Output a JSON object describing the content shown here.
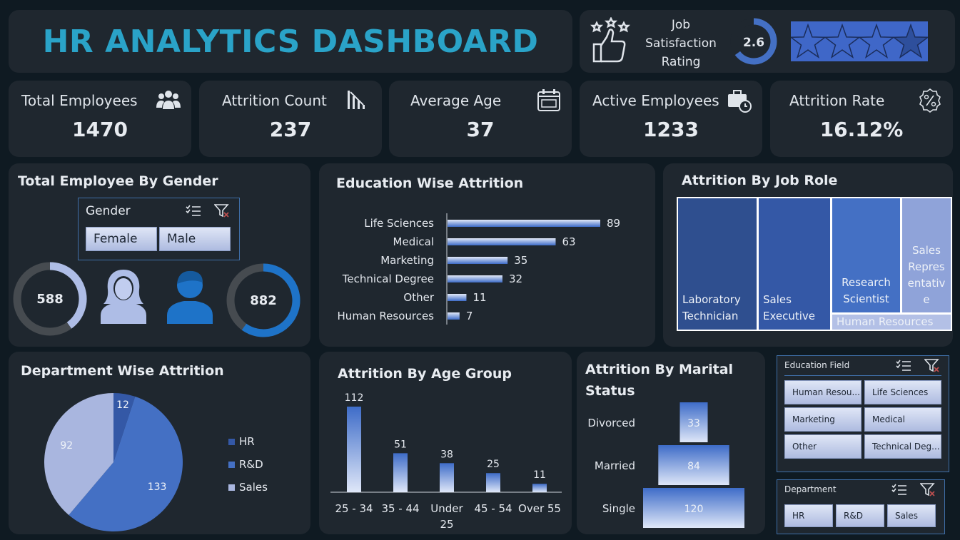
{
  "header": {
    "title": "HR ANALYTICS DASHBOARD"
  },
  "job_satisfaction": {
    "label_line1": "Job",
    "label_line2": "Satisfaction",
    "label_line3": "Rating",
    "value": "2.6",
    "rating_value": 2.6,
    "rating_max": 4
  },
  "kpis": [
    {
      "label": "Total Employees",
      "value": "1470",
      "icon": "people-icon"
    },
    {
      "label": "Attrition Count",
      "value": "237",
      "icon": "chart-down-icon"
    },
    {
      "label": "Average Age",
      "value": "37",
      "icon": "calendar-icon"
    },
    {
      "label": "Active Employees",
      "value": "1233",
      "icon": "briefcase-clock-icon"
    },
    {
      "label": "Attrition Rate",
      "value": "16.12%",
      "icon": "percent-badge-icon"
    }
  ],
  "gender": {
    "title": "Total Employee By Gender",
    "slicer_label": "Gender",
    "options": [
      "Female",
      "Male"
    ],
    "female_value": "588",
    "male_value": "882",
    "female_count": 588,
    "male_count": 882,
    "total": 1470,
    "colors": {
      "female": "#aebde6",
      "male": "#1e73c8",
      "ring_bg": "#464b50"
    }
  },
  "education_attrition": {
    "title": "Education Wise Attrition",
    "chart_data": {
      "type": "bar",
      "orientation": "horizontal",
      "categories": [
        "Life Sciences",
        "Medical",
        "Marketing",
        "Technical Degree",
        "Other",
        "Human Resources"
      ],
      "values": [
        89,
        63,
        35,
        32,
        11,
        7
      ],
      "labels": [
        "89",
        "63",
        "35",
        "32",
        "11",
        "7"
      ]
    }
  },
  "job_role": {
    "title": "Attrition By Job Role",
    "chart_data": {
      "type": "treemap",
      "tiles": [
        {
          "label": "Laboratory Technician",
          "lines": [
            "Laboratory",
            "Technician"
          ],
          "color": "#2f4f8f"
        },
        {
          "label": "Sales Executive",
          "lines": [
            "Sales",
            "Executive"
          ],
          "color": "#3458a6"
        },
        {
          "label": "Research Scientist",
          "lines": [
            "Research",
            "Scientist"
          ],
          "color": "#4470c4"
        },
        {
          "label": "Sales Representative",
          "lines": [
            "Sales",
            "Repres",
            "entativ",
            "e"
          ],
          "color": "#8fa3d9"
        },
        {
          "label": "Human Resources",
          "lines": [
            "Human Resources"
          ],
          "color": "#b3c0e6"
        }
      ]
    }
  },
  "department": {
    "title": "Department Wise Attrition",
    "chart_data": {
      "type": "pie",
      "categories": [
        "HR",
        "R&D",
        "Sales"
      ],
      "values": [
        12,
        133,
        92
      ],
      "labels": [
        "12",
        "133",
        "92"
      ],
      "colors": [
        "#3458a6",
        "#4470c4",
        "#a9b6df"
      ]
    },
    "legend": [
      "HR",
      "R&D",
      "Sales"
    ]
  },
  "age_group": {
    "title": "Attrition By Age Group",
    "chart_data": {
      "type": "bar",
      "categories": [
        "25 - 34",
        "35 - 44",
        "Under 25",
        "45 - 54",
        "Over 55"
      ],
      "category_lines": [
        [
          "25 - 34"
        ],
        [
          "35 - 44"
        ],
        [
          "Under",
          "25"
        ],
        [
          "45 - 54"
        ],
        [
          "Over 55"
        ]
      ],
      "values": [
        112,
        51,
        38,
        25,
        11
      ],
      "labels": [
        "112",
        "51",
        "38",
        "25",
        "11"
      ]
    }
  },
  "marital": {
    "title_line1": "Attrition By Marital",
    "title_line2": "Status",
    "chart_data": {
      "type": "bar",
      "orientation": "funnel",
      "categories": [
        "Divorced",
        "Married",
        "Single"
      ],
      "values": [
        33,
        84,
        120
      ],
      "labels": [
        "33",
        "84",
        "120"
      ]
    }
  },
  "education_slicer": {
    "label": "Education Field",
    "options": [
      "Human Resou...",
      "Life Sciences",
      "Marketing",
      "Medical",
      "Other",
      "Technical Deg..."
    ]
  },
  "department_slicer": {
    "label": "Department",
    "options": [
      "HR",
      "R&D",
      "Sales"
    ]
  }
}
